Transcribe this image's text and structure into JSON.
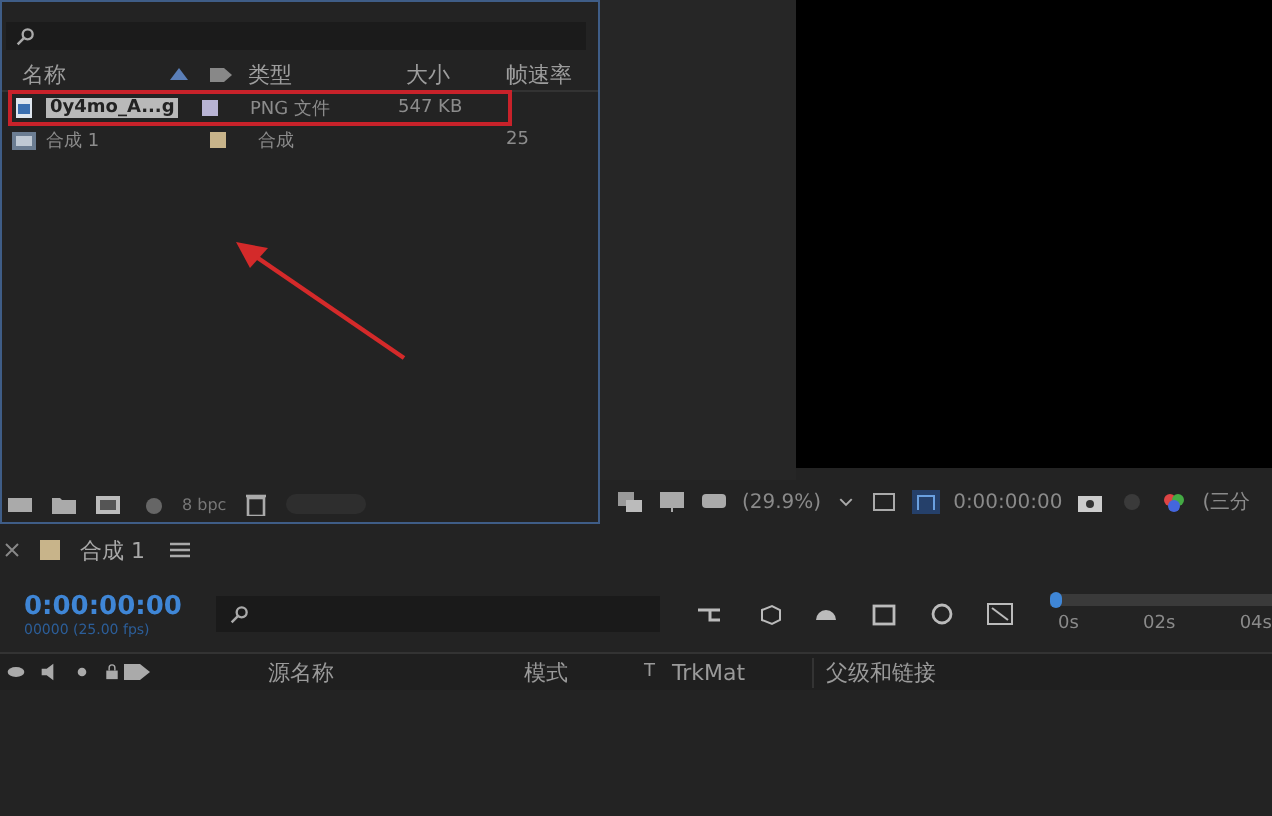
{
  "project": {
    "columns": [
      "名称",
      "类型",
      "大小",
      "帧速率"
    ],
    "items": [
      {
        "name": "0y4mo_A...g",
        "kind": "png",
        "color": "#b8b4d4",
        "type": "PNG 文件",
        "size": "547 KB",
        "selected": true,
        "outlined": true
      },
      {
        "name": "合成 1",
        "kind": "comp",
        "color": "#c8b48a",
        "type": "合成",
        "fps": "25",
        "selected": false,
        "outlined": false
      }
    ],
    "bpc": "8 bpc"
  },
  "viewer": {
    "zoom": "(29.9%)",
    "timecode": "0:00:00:00",
    "view": "(三分"
  },
  "timeline": {
    "tab": "合成 1",
    "timecode": "0:00:00:00",
    "frame_info": "00000 (25.00 fps)",
    "ruler": [
      "0s",
      "02s",
      "04s"
    ],
    "columns": [
      "源名称",
      "模式",
      "T",
      "TrkMat",
      "父级和链接"
    ]
  }
}
